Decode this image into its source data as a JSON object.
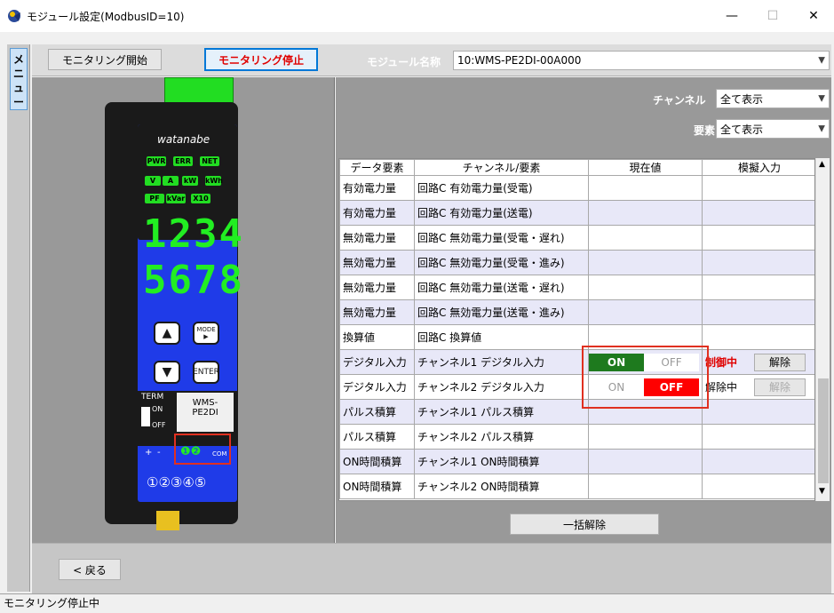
{
  "window": {
    "title": "モジュール設定(ModbusID=10)",
    "min": "—",
    "max": "☐",
    "close": "✕"
  },
  "menu": {
    "tab_label": "メニュー"
  },
  "toolbar": {
    "start_label": "モニタリング開始",
    "stop_label": "モニタリング停止",
    "module_name_label": "モジュール名称",
    "module_name_value": "10:WMS-PE2DI-00A000"
  },
  "filters": {
    "channel_label": "チャンネル",
    "channel_value": "全て表示",
    "element_label": "要素",
    "element_value": "全て表示"
  },
  "device": {
    "brand": "watanabe",
    "leds_row1": [
      "PWR",
      "ERR",
      "NET"
    ],
    "leds_row2": [
      "V",
      "A",
      "kW",
      "kWh"
    ],
    "leds_row3": [
      "PF",
      "kVar",
      "X10"
    ],
    "display_line1": "1234",
    "display_line2": "5678",
    "btn_up": "▲",
    "btn_mode": "MODE",
    "btn_down": "▼",
    "btn_enter": "ENTER",
    "term_label": "TERM",
    "switch_on": "ON",
    "switch_off": "OFF",
    "model_line1": "WMS-",
    "model_line2": "PE2DI",
    "terminal_plus": "+",
    "terminal_minus": "-",
    "terminal_di": "❶❷",
    "terminal_com": "COM",
    "terminal_bottom": "①②③④⑤"
  },
  "table": {
    "headers": [
      "データ要素",
      "チャンネル/要素",
      "現在値",
      "模擬入力"
    ],
    "rows": [
      {
        "element": "有効電力量",
        "channel": "回路C 有効電力量(受電)"
      },
      {
        "element": "有効電力量",
        "channel": "回路C 有効電力量(送電)"
      },
      {
        "element": "無効電力量",
        "channel": "回路C 無効電力量(受電・遅れ)"
      },
      {
        "element": "無効電力量",
        "channel": "回路C 無効電力量(受電・進み)"
      },
      {
        "element": "無効電力量",
        "channel": "回路C 無効電力量(送電・遅れ)"
      },
      {
        "element": "無効電力量",
        "channel": "回路C 無効電力量(送電・進み)"
      },
      {
        "element": "換算値",
        "channel": "回路C 換算値"
      },
      {
        "element": "デジタル入力",
        "channel": "チャンネル1 デジタル入力",
        "on": "ON",
        "off": "OFF",
        "status": "制御中",
        "release": "解除"
      },
      {
        "element": "デジタル入力",
        "channel": "チャンネル2 デジタル入力",
        "on": "ON",
        "off": "OFF",
        "status": "解除中",
        "release": "解除"
      },
      {
        "element": "パルス積算",
        "channel": "チャンネル1 パルス積算"
      },
      {
        "element": "パルス積算",
        "channel": "チャンネル2 パルス積算"
      },
      {
        "element": "ON時間積算",
        "channel": "チャンネル1 ON時間積算"
      },
      {
        "element": "ON時間積算",
        "channel": "チャンネル2 ON時間積算"
      }
    ]
  },
  "bulk_release_label": "一括解除",
  "back_label": "< 戻る",
  "status_text": "モニタリング停止中",
  "colors": {
    "on_active": "#1e7a1e",
    "off_active": "#ff0000",
    "highlight": "#e03020"
  }
}
